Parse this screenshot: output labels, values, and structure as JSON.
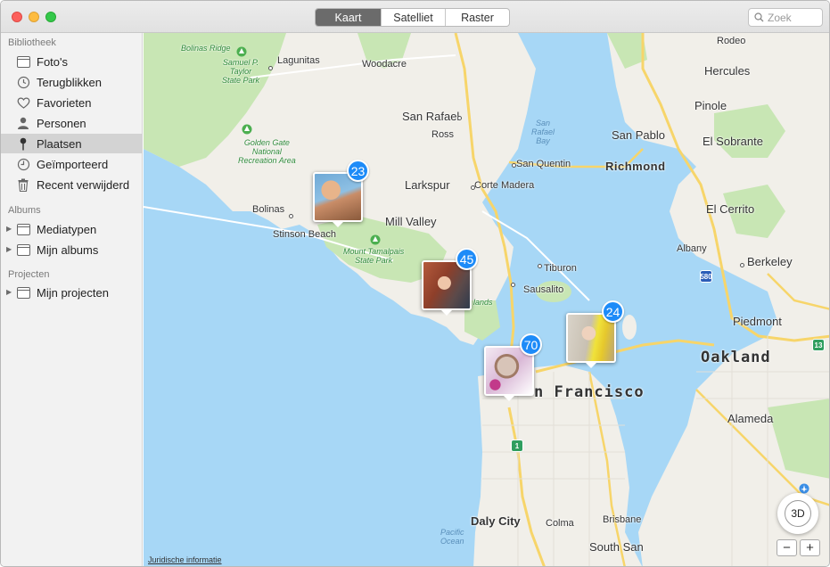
{
  "toolbar": {
    "segments": [
      {
        "label": "Kaart",
        "active": true
      },
      {
        "label": "Satelliet",
        "active": false
      },
      {
        "label": "Raster",
        "active": false
      }
    ],
    "search_placeholder": "Zoek",
    "search_icon": "magnifying-glass-icon"
  },
  "sidebar": {
    "library_title": "Bibliotheek",
    "library_items": [
      {
        "label": "Foto's",
        "icon": "photos-icon"
      },
      {
        "label": "Terugblikken",
        "icon": "memories-icon"
      },
      {
        "label": "Favorieten",
        "icon": "heart-icon"
      },
      {
        "label": "Personen",
        "icon": "person-icon"
      },
      {
        "label": "Plaatsen",
        "icon": "pin-icon",
        "selected": true
      },
      {
        "label": "Geïmporteerd",
        "icon": "clock-icon"
      },
      {
        "label": "Recent verwijderd",
        "icon": "trash-icon"
      }
    ],
    "albums_title": "Albums",
    "album_items": [
      {
        "label": "Mediatypen",
        "icon": "folder-icon"
      },
      {
        "label": "Mijn albums",
        "icon": "folder-icon"
      }
    ],
    "projects_title": "Projecten",
    "project_items": [
      {
        "label": "Mijn projecten",
        "icon": "folder-icon"
      }
    ]
  },
  "map": {
    "places": {
      "rodeo": "Rodeo",
      "hercules": "Hercules",
      "pinole": "Pinole",
      "lagunitas": "Lagunitas",
      "woodacre": "Woodacre",
      "san_rafael": "San Rafael",
      "ross": "Ross",
      "san_pablo": "San Pablo",
      "el_sobrante": "El Sobrante",
      "san_quentin": "San Quentin",
      "richmond": "Richmond",
      "larkspur": "Larkspur",
      "corte_madera": "Corte Madera",
      "el_cerrito": "El Cerrito",
      "bolinas": "Bolinas",
      "mill_valley": "Mill Valley",
      "stinson_beach": "Stinson Beach",
      "albany": "Albany",
      "tiburon": "Tiburon",
      "berkeley": "Berkeley",
      "sausalito": "Sausalito",
      "piedmont": "Piedmont",
      "oakland": "Oakland",
      "san_francisco": "n Francisco",
      "alameda": "Alameda",
      "daly_city": "Daly City",
      "colma": "Colma",
      "brisbane": "Brisbane",
      "south_san": "South San",
      "lands": "lands"
    },
    "parks": {
      "bolinas_ridge": "Bolinas Ridge",
      "taylor": "Samuel P.\nTaylor\nState Park",
      "golden_gate": "Golden Gate\nNational\nRecreation Area",
      "tamalpais": "Mount Tamalpais\nState Park"
    },
    "water": {
      "san_rafael_bay": "San\nRafael\nBay",
      "pacific": "Pacific\nOcean"
    },
    "shields": {
      "i580": "580",
      "hw1": "1",
      "hw13": "13"
    },
    "clusters": [
      {
        "count": "23",
        "photo": "shirtless-man-photo"
      },
      {
        "count": "45",
        "photo": "woman-red-hair-photo"
      },
      {
        "count": "70",
        "photo": "cake-photo"
      },
      {
        "count": "24",
        "photo": "woman-yellow-hair-photo"
      }
    ],
    "compass_label": "3D",
    "zoom_out_label": "−",
    "zoom_in_label": "+",
    "legal_label": "Juridische informatie"
  },
  "colors": {
    "water": "#a7d7f6",
    "land": "#f1efe9",
    "park": "#c8e6b4",
    "road": "#f7d56a",
    "badge": "#1d8bf8"
  }
}
